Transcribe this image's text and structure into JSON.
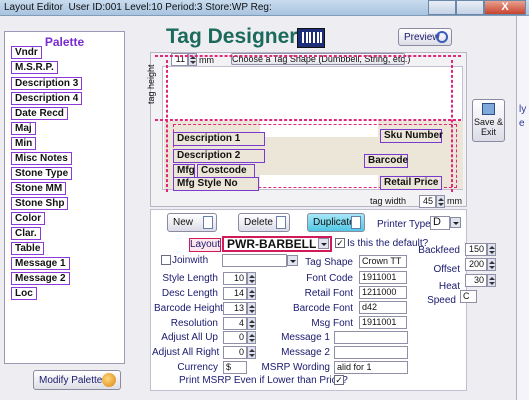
{
  "window": {
    "title": "Layout Editor",
    "info": "User ID:001 Level:10 Period:3 Store:WP Reg:",
    "close_label": "X",
    "right_fragments": [
      "ly",
      "e"
    ]
  },
  "palette": {
    "title": "Palette",
    "items": [
      "Vndr",
      "M.S.R.P.",
      "Description 3",
      "Description 4",
      "Date Recd",
      "Maj",
      "Min",
      "Misc Notes",
      "Stone Type",
      "Stone MM",
      "Stone Shp",
      "Color",
      "Clar.",
      "Table",
      "Message 1",
      "Message 2",
      "Loc"
    ],
    "modify_label": "Modify Palette"
  },
  "designer": {
    "title": "Tag Designer",
    "preview_label": "Preview",
    "tag_height_value": "11",
    "tag_height_unit": "mm",
    "tag_height_label": "tag height",
    "shape_select": "Choose a Tag Shape (Dumbbell, String, etc.)",
    "tag_width_label": "tag width",
    "tag_width_value": "45",
    "tag_width_unit": "mm",
    "fields": {
      "description1": "Description 1",
      "description2": "Description 2",
      "mfg": "Mfg",
      "costcode": "Costcode",
      "mfg_style": "Mfg Style No",
      "sku": "Sku Number",
      "barcode": "Barcode",
      "retail_price": "Retail Price"
    },
    "save_exit_label": "Save & Exit"
  },
  "controls": {
    "new_label": "New",
    "delete_label": "Delete",
    "duplicate_label": "Duplicate",
    "printer_type_label": "Printer Type",
    "printer_type_value": "D",
    "layout_label": "Layout",
    "layout_value": "PWR-BARBELL",
    "default_label": "Is this the default?",
    "default_checked": "✓",
    "joinwith_label": "Joinwith",
    "left_fields": [
      {
        "label": "Style Length",
        "value": "10"
      },
      {
        "label": "Desc Length",
        "value": "14"
      },
      {
        "label": "Barcode Height",
        "value": "13"
      },
      {
        "label": "Resolution",
        "value": "4"
      },
      {
        "label": "Adjust All Up",
        "value": "0"
      },
      {
        "label": "Adjust All Right",
        "value": "0"
      },
      {
        "label": "Currency",
        "value": "$"
      }
    ],
    "mid_fields": [
      {
        "label": "Tag Shape",
        "value": "Crown TT"
      },
      {
        "label": "Font Code",
        "value": "1911001"
      },
      {
        "label": "Retail Font",
        "value": "1211000"
      },
      {
        "label": "Barcode Font",
        "value": "d42"
      },
      {
        "label": "Msg Font",
        "value": "1911001"
      },
      {
        "label": "Message 1",
        "value": ""
      },
      {
        "label": "Message 2",
        "value": ""
      },
      {
        "label": "MSRP Wording",
        "value": "alid for 1"
      }
    ],
    "right_fields": [
      {
        "label": "Backfeed",
        "value": "150"
      },
      {
        "label": "Offset",
        "value": "200"
      },
      {
        "label": "Heat",
        "value": "30"
      },
      {
        "label": "Speed",
        "value": "C"
      }
    ],
    "print_msrp_label": "Print MSRP Even if Lower than Price?",
    "print_msrp_checked": "✓"
  }
}
